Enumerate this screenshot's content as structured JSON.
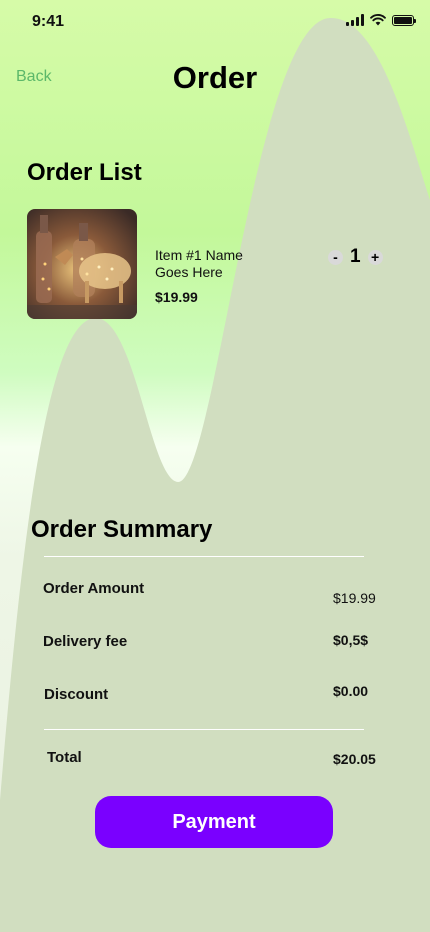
{
  "status": {
    "time": "9:41"
  },
  "header": {
    "back_label": "Back",
    "title": "Order"
  },
  "order_list": {
    "title": "Order List",
    "items": [
      {
        "name": "Item #1 Name Goes Here",
        "price": "$19.99",
        "quantity": "1",
        "decrement": "-",
        "increment": "+"
      }
    ]
  },
  "summary": {
    "title": "Order Summary",
    "rows": [
      {
        "label": "Order Amount",
        "value": "$19.99"
      },
      {
        "label": "Delivery fee",
        "value": "$0,5$"
      },
      {
        "label": "Discount",
        "value": "$0.00"
      }
    ],
    "total_label": "Total",
    "total_value": "$20.05"
  },
  "payment": {
    "label": "Payment"
  },
  "colors": {
    "accent": "#7a00ff",
    "back_link": "#5cb86a",
    "wave": "#d1dec0"
  }
}
